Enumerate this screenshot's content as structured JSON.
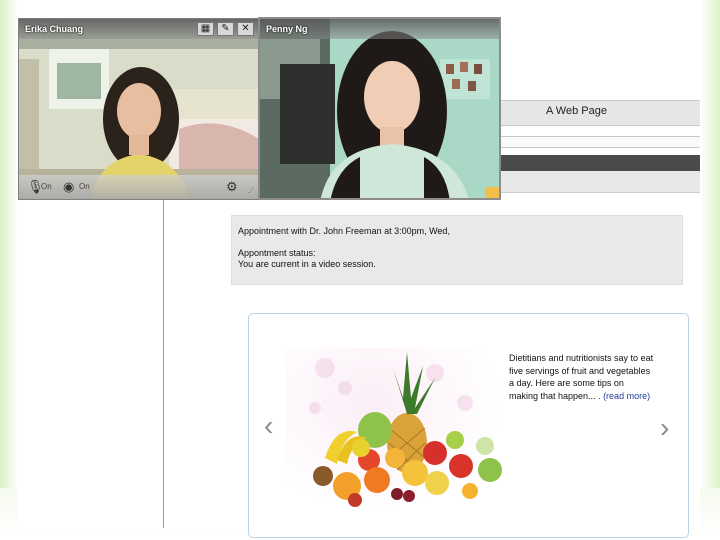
{
  "page": {
    "title": "A Web Page"
  },
  "appointment": {
    "line1": "Appointment with Dr. John Freeman at 3:00pm, Wed,",
    "status_label": "Appontment status:",
    "status_value": "You are current in a video session."
  },
  "carousel": {
    "text": "Dietitians and nutritionists say to eat five servings of fruit and vegetables a day. Here are some tips on making that happen... . ",
    "read_more": "(read more)",
    "prev_icon": "‹",
    "next_icon": "›"
  },
  "video_left": {
    "name": "Erika Chuang",
    "mic_label": "On",
    "cam_label": "On"
  },
  "video_right": {
    "name": "Penny Ng"
  },
  "colors": {
    "link": "#223a98",
    "carousel_border": "#b9d3e8",
    "dark_bar": "#4a4a4a"
  }
}
